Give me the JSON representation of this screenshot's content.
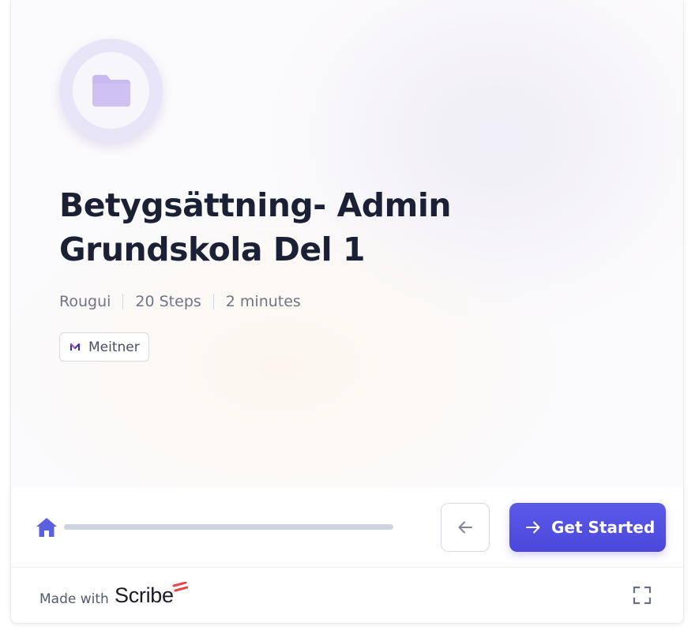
{
  "guide": {
    "title": "Betygsättning- Admin Grundskola Del 1",
    "author": "Rougui",
    "steps": "20 Steps",
    "duration": "2 minutes",
    "tag": "Meitner"
  },
  "navigation": {
    "progress_fraction": 0,
    "back_icon": "arrow-left-icon",
    "start_label": "Get Started",
    "start_icon": "arrow-right-icon",
    "home_icon": "home-icon"
  },
  "footer": {
    "made_with": "Made with",
    "brand": "Scribe",
    "expand_icon": "expand-icon"
  },
  "colors": {
    "accent": "#5b5ae8",
    "title": "#1b2035",
    "folder": "#c8b9f0",
    "brand_mark": "#e5484d"
  }
}
